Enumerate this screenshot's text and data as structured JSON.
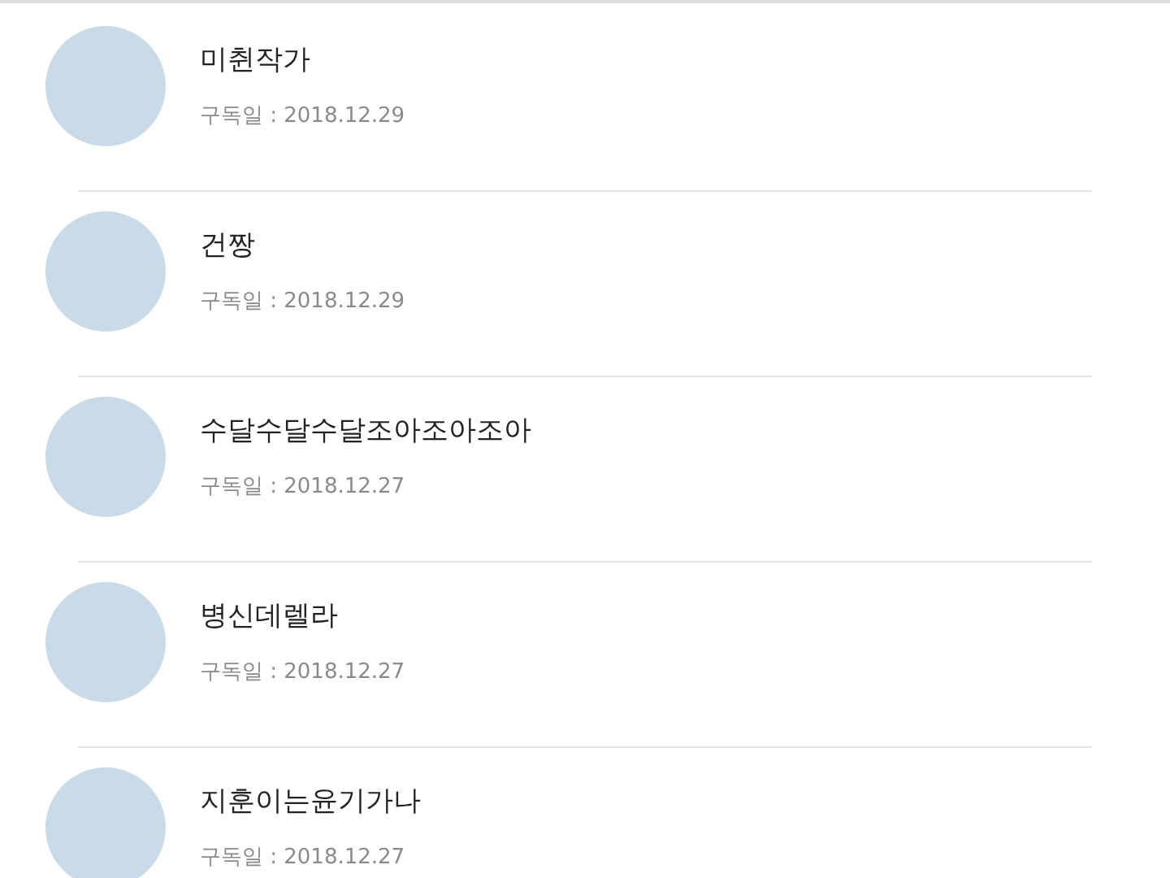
{
  "subscribers": [
    {
      "name": "미췬작가",
      "subscribed": "구독일 : 2018.12.29"
    },
    {
      "name": "건짱",
      "subscribed": "구독일 : 2018.12.29"
    },
    {
      "name": "수달수달수달조아조아조아",
      "subscribed": "구독일 : 2018.12.27"
    },
    {
      "name": "병신데렐라",
      "subscribed": "구독일 : 2018.12.27"
    },
    {
      "name": "지훈이는윤기가나",
      "subscribed": "구독일 : 2018.12.27"
    }
  ]
}
